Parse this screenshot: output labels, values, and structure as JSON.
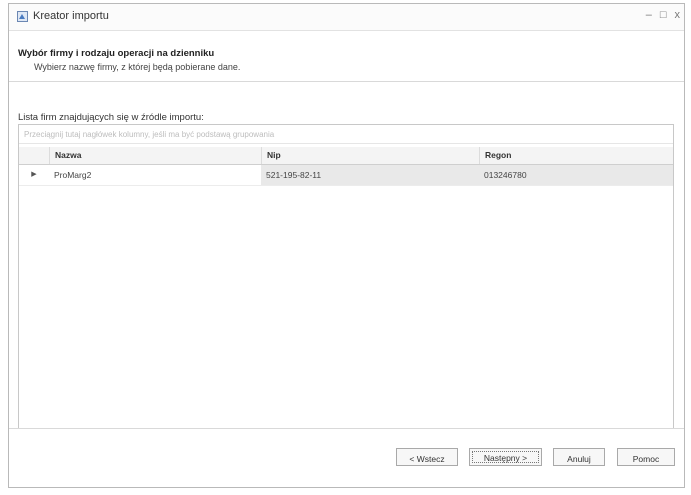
{
  "window": {
    "title": "Kreator importu",
    "controls": {
      "minimize": "–",
      "maximize": "□",
      "close": "x"
    }
  },
  "header": {
    "title": "Wybór firmy i rodzaju operacji na dzienniku",
    "subtitle": "Wybierz nazwę firmy, z której będą pobierane dane."
  },
  "content": {
    "list_label": "Lista firm znajdujących się w źródle importu:",
    "group_hint": "Przeciągnij tutaj nagłówek kolumny, jeśli ma być podstawą grupowania",
    "columns": [
      "Nazwa",
      "Nip",
      "Regon"
    ],
    "rows": [
      {
        "indicator": "▶",
        "nazwa": "ProMarg2",
        "nip": "521-195-82-11",
        "regon": "013246780"
      }
    ]
  },
  "footer": {
    "back": "< Wstecz",
    "next": "Następny >",
    "cancel": "Anuluj",
    "help": "Pomoc"
  }
}
